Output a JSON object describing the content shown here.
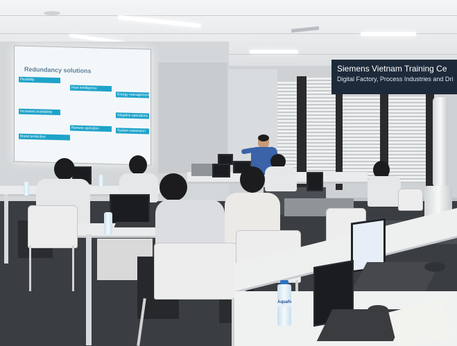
{
  "banner": {
    "title": "Siemens Vietnam Training Ce",
    "subtitle": "Digital Factory, Process Industries and Dri"
  },
  "slide": {
    "title": "Redundancy solutions",
    "boxes": [
      "Flexibility",
      "Host intelligence",
      "Energy management",
      "Increased availability",
      "Adaptive operations",
      "Remote operation",
      "System expansion",
      "Brand protection",
      ""
    ]
  },
  "bottle_label": "Aquafina",
  "colors": {
    "banner_bg": "#1d2a3a",
    "slide_accent": "#1ea3c9",
    "floor": "#3a3d42"
  }
}
